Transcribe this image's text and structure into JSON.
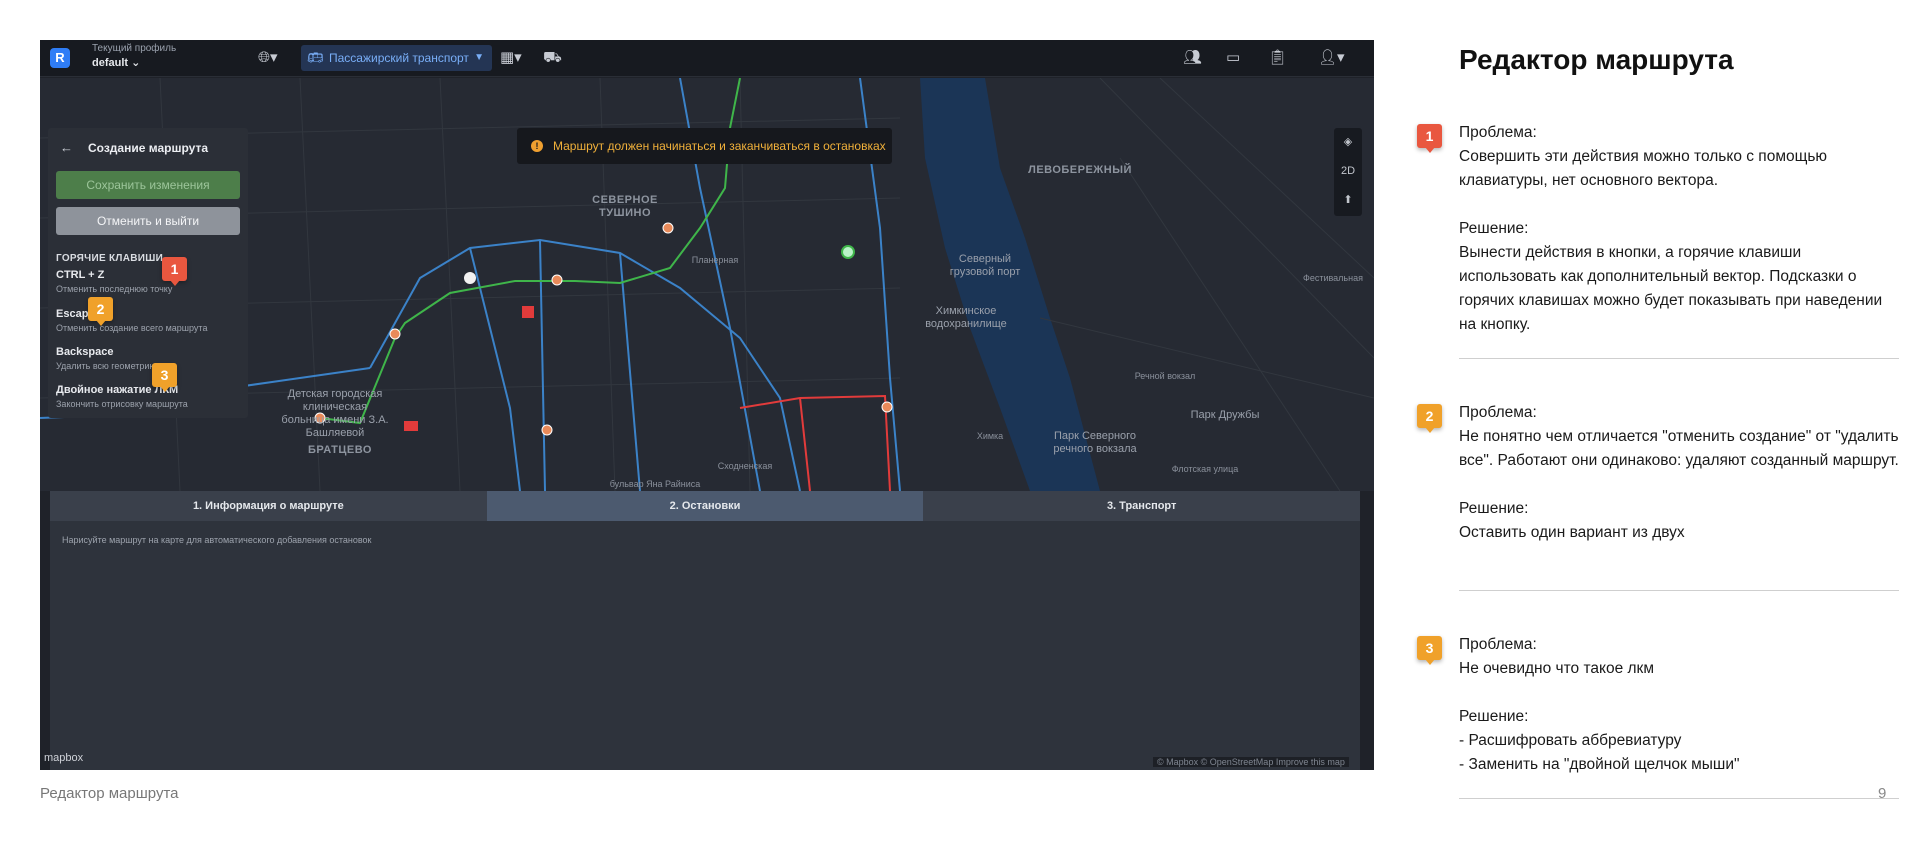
{
  "app": {
    "profile_caption": "Текущий профиль",
    "profile_value": "default",
    "transport_label": "Пассажирский транспорт"
  },
  "map": {
    "warning": "Маршрут должен начинаться и заканчиваться в остановках",
    "controls_2d": "2D",
    "labels": {
      "severnoe_tushino": "СЕВЕРНОЕ ТУШИНО",
      "levoberezhny": "ЛЕВОБЕРЕЖНЫЙ",
      "bratsevo": "БРАТЦЕВО",
      "severny_port": "Северный грузовой порт",
      "khimkinskoe": "Химкинское водохранилище",
      "hospital": "Детская городская клиническая больница имени З.А. Башляевой",
      "park_severnogo": "Парк Северного речного вокзала",
      "park_druzhby": "Парк Дружбы",
      "planernaya": "Планерная",
      "rechnoy_vokzal": "Речной вокзал",
      "flotskaya": "Флотская улица",
      "khimka": "Химка",
      "bulvar_yana": "бульвар Яна Райниса",
      "skhodnenskaya": "Сходненская",
      "festivalnaya": "Фестивальная"
    },
    "attribution": "© Mapbox © OpenStreetMap  Improve this map",
    "mapbox": "mapbox"
  },
  "panel": {
    "back": "←",
    "title": "Создание маршрута",
    "save": "Сохранить изменения",
    "cancel": "Отменить и выйти",
    "hotkeys_title": "ГОРЯЧИЕ КЛАВИШИ",
    "hotkeys": [
      {
        "key": "CTRL + Z",
        "desc": "Отменить последнюю точку"
      },
      {
        "key": "Escape",
        "desc": "Отменить создание всего маршрута"
      },
      {
        "key": "Backspace",
        "desc": "Удалить всю геометрию"
      },
      {
        "key": "Двойное нажатие ЛКМ",
        "desc": "Закончить отрисовку маршрута"
      }
    ]
  },
  "tabs": [
    {
      "label": "1. Информация о маршруте"
    },
    {
      "label": "2. Остановки"
    },
    {
      "label": "3. Транспорт"
    }
  ],
  "tab_hint": "Нарисуйте маршрут на карте для автоматического добавления остановок",
  "badges": [
    "1",
    "2",
    "3"
  ],
  "doc": {
    "title": "Редактор маршрута",
    "notes": [
      {
        "problem_label": "Проблема:",
        "problem": "Совершить эти действия можно только с помощью клавиатуры, нет основного вектора.",
        "solution_label": "Решение:",
        "solution": "Вынести действия в кнопки, а горячие клавиши использовать как дополнительный вектор. Подсказки о горячих клавишах можно будет показывать при наведении на кнопку."
      },
      {
        "problem_label": "Проблема:",
        "problem": "Не понятно чем отличается \"отменить создание\" от \"удалить все\". Работают они одинаково: удаляют созданный маршрут.",
        "solution_label": "Решение:",
        "solution": "Оставить один вариант из двух"
      },
      {
        "problem_label": "Проблема:",
        "problem": "Не очевидно что такое лкм",
        "solution_label": "Решение:",
        "solution_lines": [
          "- Расшифровать аббревиатуру",
          "- Заменить на \"двойной щелчок мыши\""
        ]
      }
    ],
    "footer_left": "Редактор маршрута",
    "page_number": "9"
  },
  "colors": {
    "badge_red": "#e9573f",
    "badge_orange": "#f0a12a",
    "route_green": "#3fb54a",
    "route_red": "#e23b3b",
    "route_blue": "#3b82c8",
    "water": "#1b3556"
  }
}
